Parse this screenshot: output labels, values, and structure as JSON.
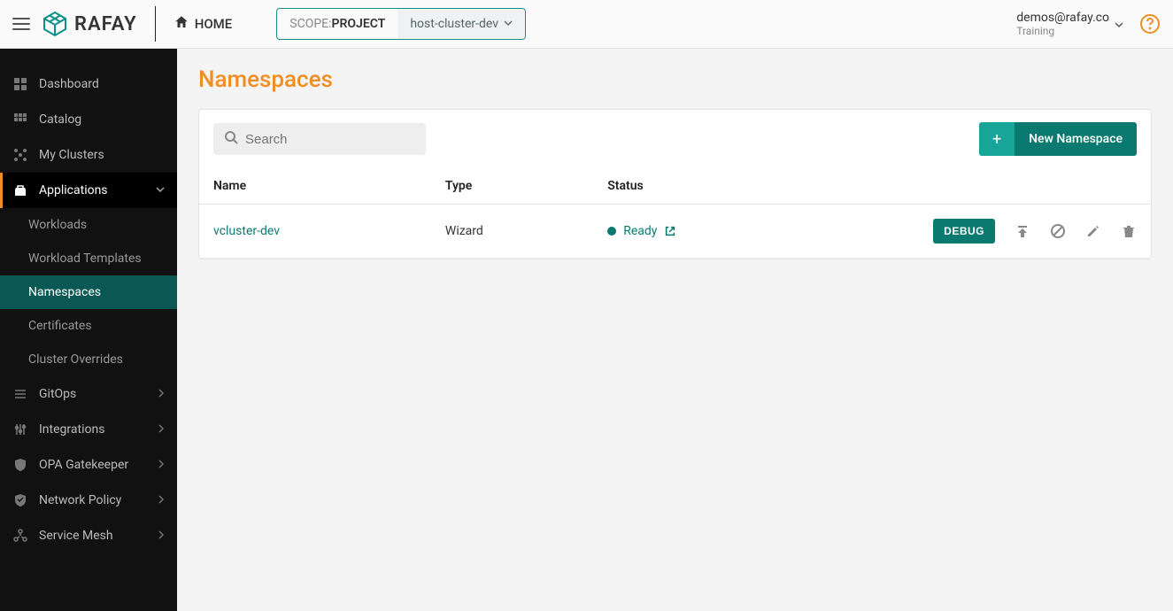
{
  "header": {
    "home_label": "HOME",
    "scope_prefix": "SCOPE: ",
    "scope_kind": "PROJECT",
    "scope_value": "host-cluster-dev",
    "user_email": "demos@rafay.co",
    "user_org": "Training",
    "logo_text": "RAFAY"
  },
  "sidebar": {
    "items": [
      {
        "label": "Dashboard",
        "icon": "grid"
      },
      {
        "label": "Catalog",
        "icon": "grid2"
      },
      {
        "label": "My Clusters",
        "icon": "grid3"
      },
      {
        "label": "Applications",
        "icon": "bag",
        "active": true,
        "expanded": true,
        "children": [
          {
            "label": "Workloads"
          },
          {
            "label": "Workload Templates"
          },
          {
            "label": "Namespaces",
            "active": true
          },
          {
            "label": "Certificates"
          },
          {
            "label": "Cluster Overrides"
          }
        ]
      },
      {
        "label": "GitOps",
        "icon": "bars",
        "caret": true
      },
      {
        "label": "Integrations",
        "icon": "sliders",
        "caret": true
      },
      {
        "label": "OPA Gatekeeper",
        "icon": "shield",
        "caret": true
      },
      {
        "label": "Network Policy",
        "icon": "shield2",
        "caret": true
      },
      {
        "label": "Service Mesh",
        "icon": "mesh",
        "caret": true
      }
    ]
  },
  "page": {
    "title": "Namespaces",
    "search_placeholder": "Search",
    "new_button_label": "New Namespace",
    "columns": [
      "Name",
      "Type",
      "Status"
    ],
    "debug_label": "DEBUG",
    "rows": [
      {
        "name": "vcluster-dev",
        "type": "Wizard",
        "status": "Ready"
      }
    ]
  }
}
